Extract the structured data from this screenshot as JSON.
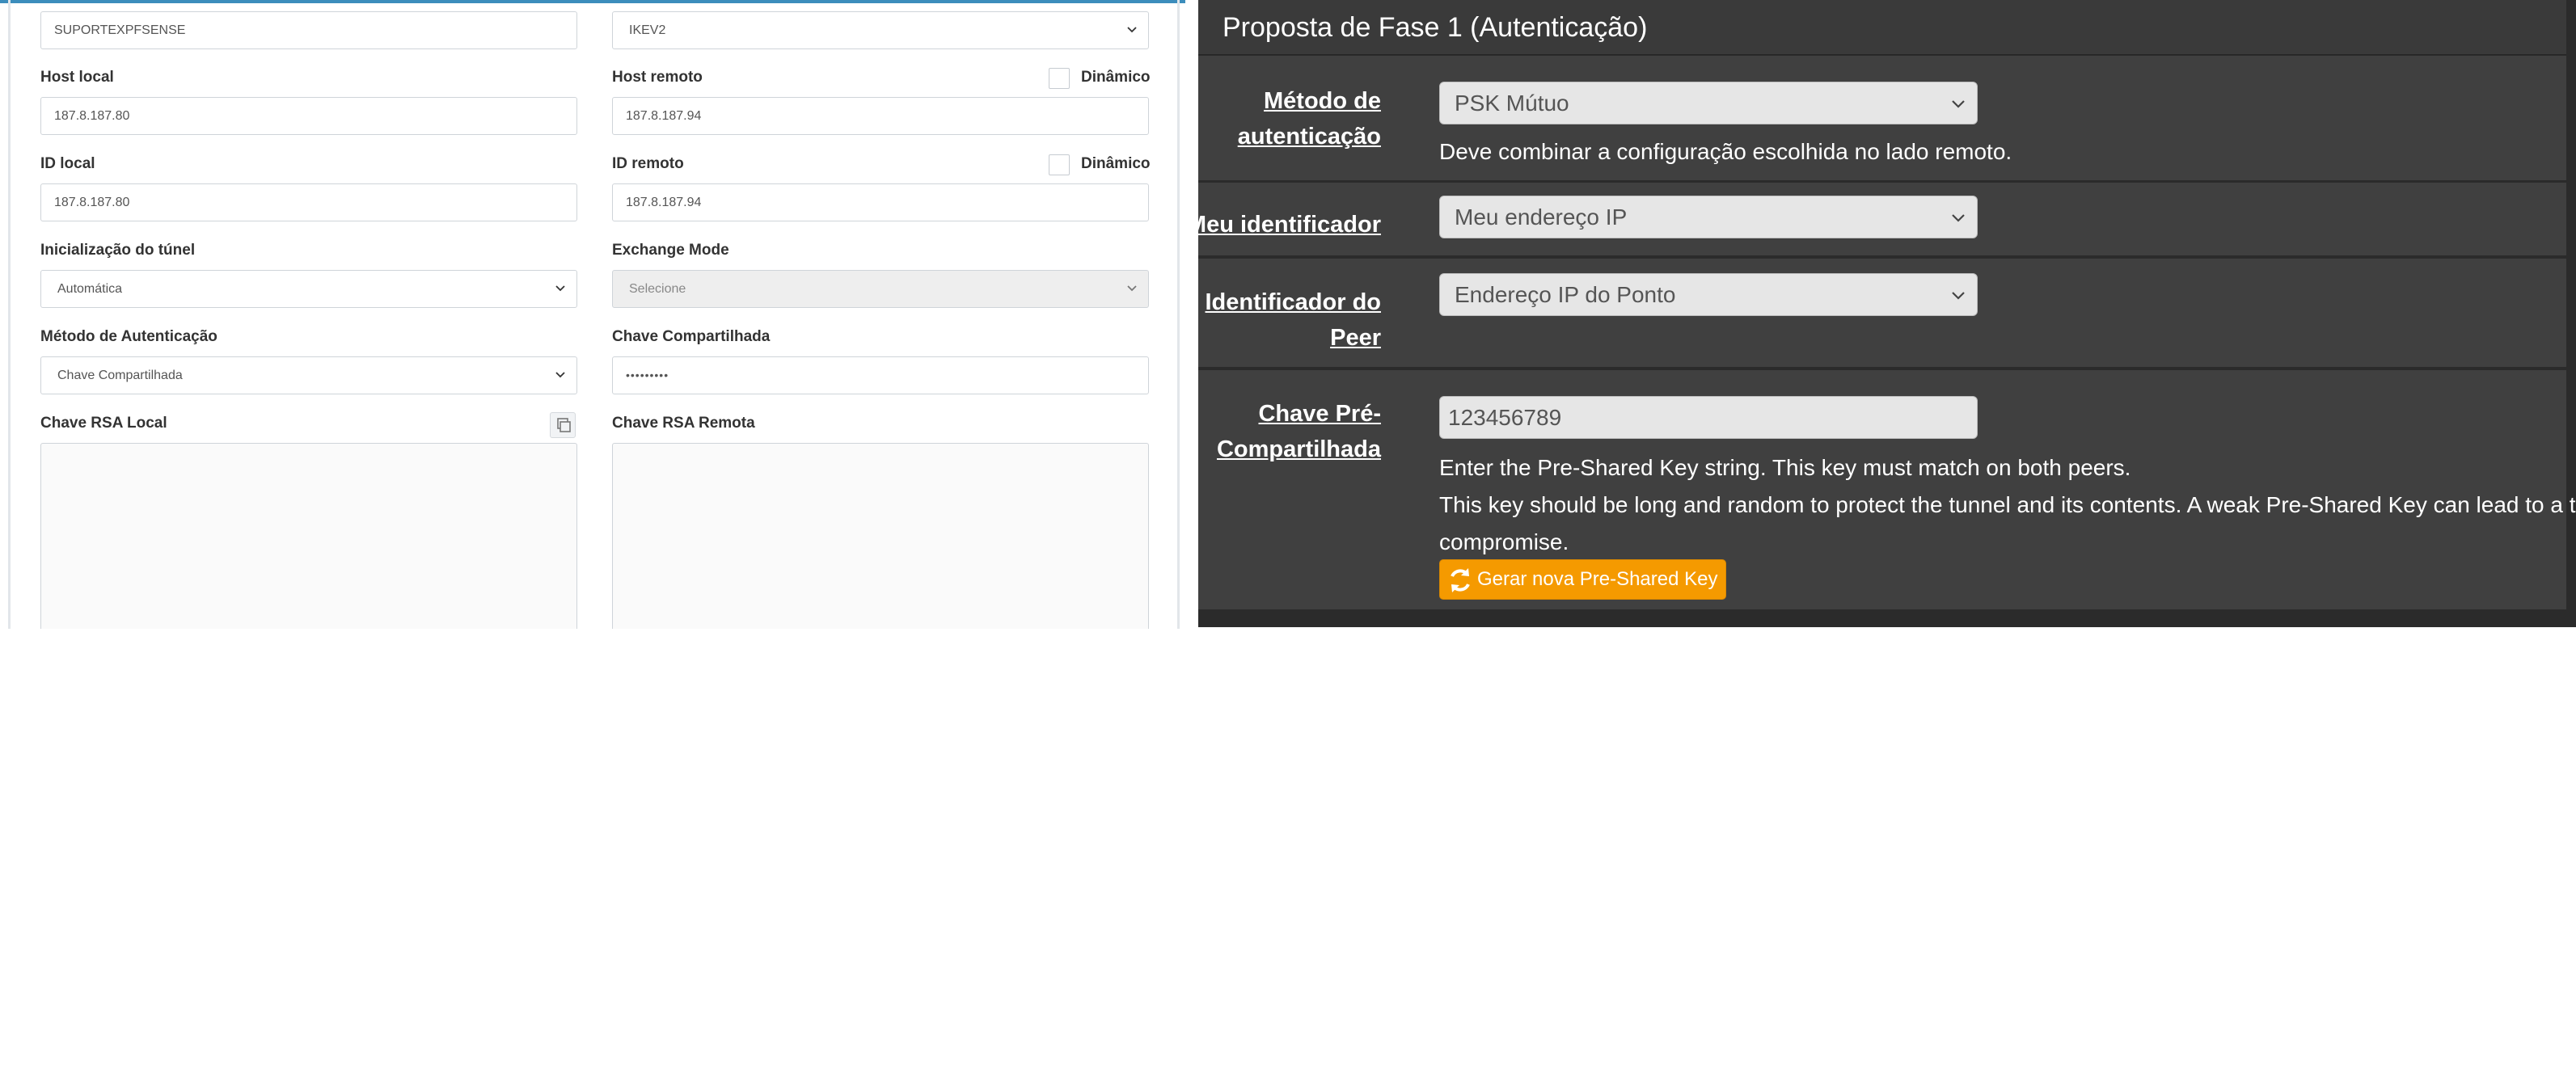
{
  "left": {
    "peer_description": "SUPORTEXPFSENSE",
    "ike_version": "IKEV2",
    "host_local": {
      "label": "Host local",
      "value": "187.8.187.80"
    },
    "host_remoto": {
      "label": "Host remoto",
      "value": "187.8.187.94",
      "checkbox_label": "Dinâmico"
    },
    "id_local": {
      "label": "ID local",
      "value": "187.8.187.80"
    },
    "id_remoto": {
      "label": "ID remoto",
      "value": "187.8.187.94",
      "checkbox_label": "Dinâmico"
    },
    "tunnel_init": {
      "label": "Inicialização do túnel",
      "value": "Automática"
    },
    "exchange_mode": {
      "label": "Exchange Mode",
      "value": "Selecione"
    },
    "auth_method": {
      "label": "Método de Autenticação",
      "value": "Chave Compartilhada"
    },
    "shared_key": {
      "label": "Chave Compartilhada",
      "value": "•••••••••"
    },
    "rsa_local": {
      "label": "Chave RSA Local"
    },
    "rsa_remote": {
      "label": "Chave RSA Remota"
    }
  },
  "right": {
    "title": "Proposta de Fase 1 (Autenticação)",
    "auth_method": {
      "label_line1": "Método de",
      "label_line2": "autenticação",
      "value": "PSK Mútuo",
      "help": "Deve combinar a configuração escolhida no lado remoto."
    },
    "my_identifier": {
      "label": "Meu identificador",
      "value": "Meu endereço IP"
    },
    "peer_identifier": {
      "label_line1": "Identificador do",
      "label_line2": "Peer",
      "value": "Endereço IP do Ponto"
    },
    "psk": {
      "label_line1": "Chave Pré-",
      "label_line2": "Compartilhada",
      "value": "123456789",
      "help_line1": "Enter the Pre-Shared Key string. This key must match on both peers.",
      "help_line2": "This key should be long and random to protect the tunnel and its contents. A weak Pre-Shared Key can lead to a tunnel",
      "help_line3": "compromise.",
      "button_label": "Gerar nova Pre-Shared Key"
    }
  }
}
